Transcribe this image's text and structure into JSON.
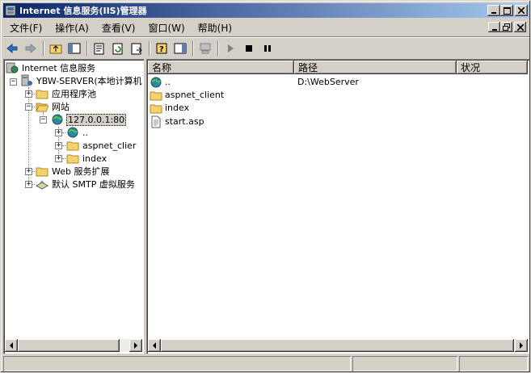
{
  "window": {
    "title": "Internet 信息服务(IIS)管理器"
  },
  "menu": [
    "文件(F)",
    "操作(A)",
    "查看(V)",
    "窗口(W)",
    "帮助(H)"
  ],
  "tree": {
    "root": "Internet 信息服务",
    "server": "YBW-SERVER(本地计算机",
    "app_pools": "应用程序池",
    "websites": "网站",
    "site": "127.0.0.1:80",
    "site_children": [
      "..",
      "aspnet_clier",
      "index"
    ],
    "web_ext": "Web 服务扩展",
    "smtp": "默认 SMTP 虚拟服务"
  },
  "list": {
    "columns": [
      "名称",
      "路径",
      "状况"
    ],
    "rows": [
      {
        "name": "..",
        "path": "D:\\WebServer",
        "icon": "globe-icon"
      },
      {
        "name": "aspnet_client",
        "path": "",
        "icon": "folder-icon"
      },
      {
        "name": "index",
        "path": "",
        "icon": "folder-icon"
      },
      {
        "name": "start.asp",
        "path": "",
        "icon": "file-icon"
      }
    ]
  }
}
